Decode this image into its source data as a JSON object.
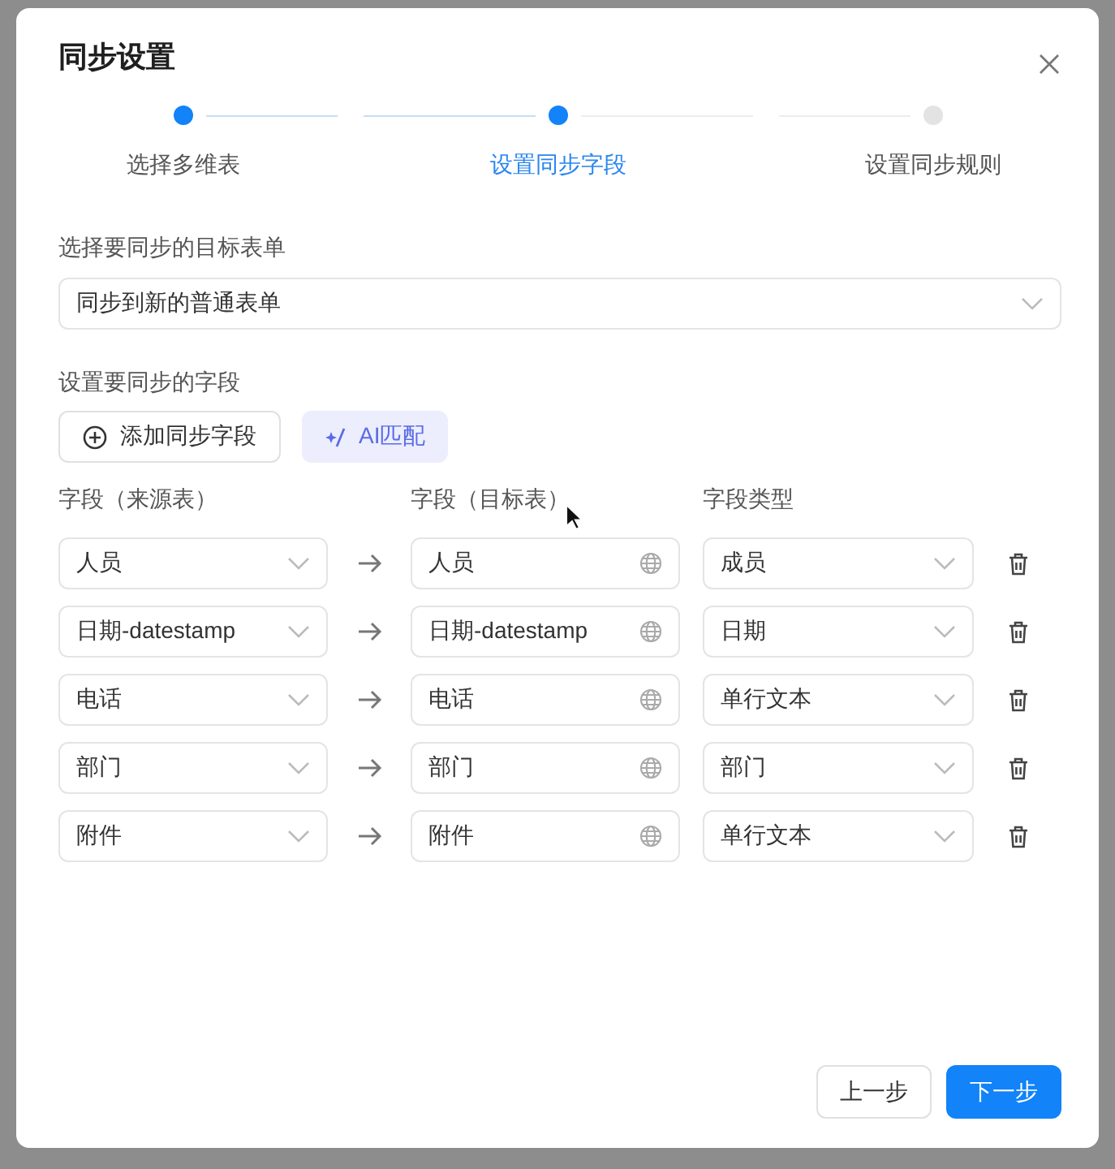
{
  "dialog": {
    "title": "同步设置"
  },
  "steps": [
    {
      "label": "选择多维表",
      "completed": true,
      "selected": false
    },
    {
      "label": "设置同步字段",
      "completed": false,
      "selected": true
    },
    {
      "label": "设置同步规则",
      "completed": false,
      "selected": false
    }
  ],
  "target_form": {
    "label": "选择要同步的目标表单",
    "value": "同步到新的普通表单"
  },
  "fields_section": {
    "label": "设置要同步的字段",
    "add_button": "添加同步字段",
    "ai_button": "AI匹配"
  },
  "columns": [
    "字段（来源表）",
    "字段（目标表）",
    "字段类型"
  ],
  "rows": [
    {
      "source": "人员",
      "target": "人员",
      "type": "成员"
    },
    {
      "source": "日期-datestamp",
      "target": "日期-datestamp",
      "type": "日期"
    },
    {
      "source": "电话",
      "target": "电话",
      "type": "单行文本"
    },
    {
      "source": "部门",
      "target": "部门",
      "type": "部门"
    },
    {
      "source": "附件",
      "target": "附件",
      "type": "单行文本"
    }
  ],
  "buttons": {
    "prev": "上一步",
    "next": "下一步"
  }
}
